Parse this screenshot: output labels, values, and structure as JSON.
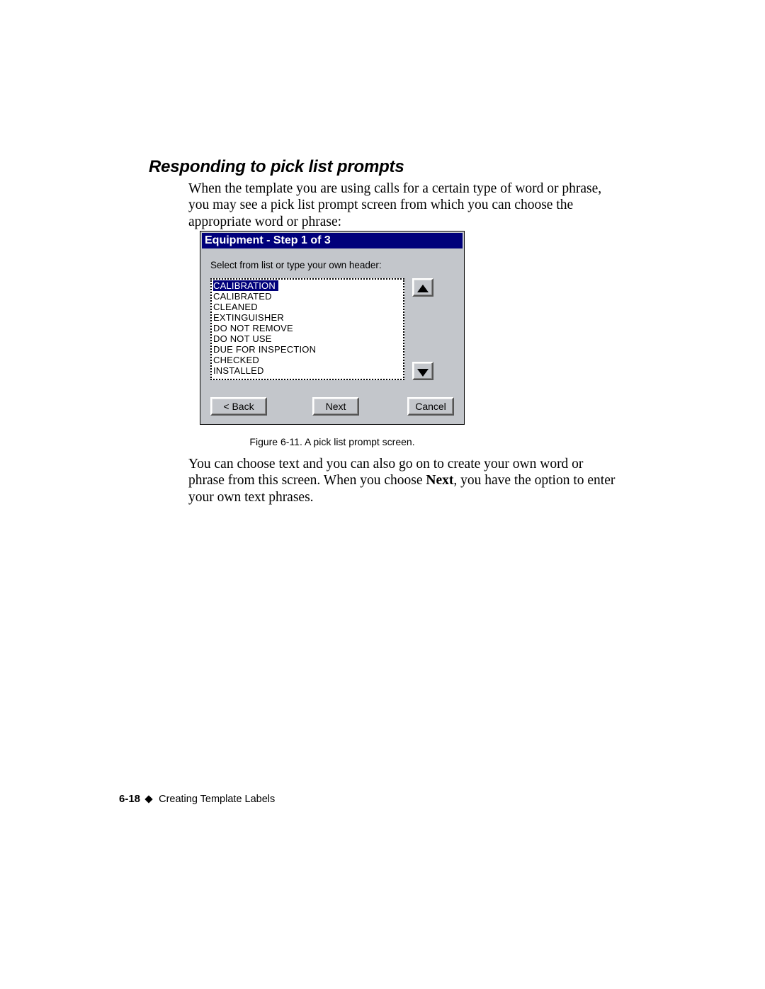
{
  "section_title": "Responding to pick list prompts",
  "intro": "When the template you are using calls for a certain type of word or phrase, you may see a pick list prompt screen from which you can choose the appropriate word or phrase:",
  "dialog": {
    "title": "Equipment - Step 1 of 3",
    "label": "Select from list or type your own header:",
    "items": [
      "CALIBRATION",
      "CALIBRATED",
      "CLEANED",
      "EXTINGUISHER",
      "DO NOT REMOVE",
      "DO NOT USE",
      "DUE FOR INSPECTION",
      "CHECKED",
      "INSTALLED"
    ],
    "selected_index": 0,
    "back": "< Back",
    "next": "Next",
    "cancel": "Cancel"
  },
  "caption": "Figure 6-11. A pick list prompt screen.",
  "para2_a": "You can choose text and you can also go on to create your own word or phrase from this screen. When you choose ",
  "para2_bold": "Next",
  "para2_b": ", you have the option to enter your own text phrases.",
  "footer": {
    "page": "6-18",
    "chapter": "Creating Template Labels"
  }
}
